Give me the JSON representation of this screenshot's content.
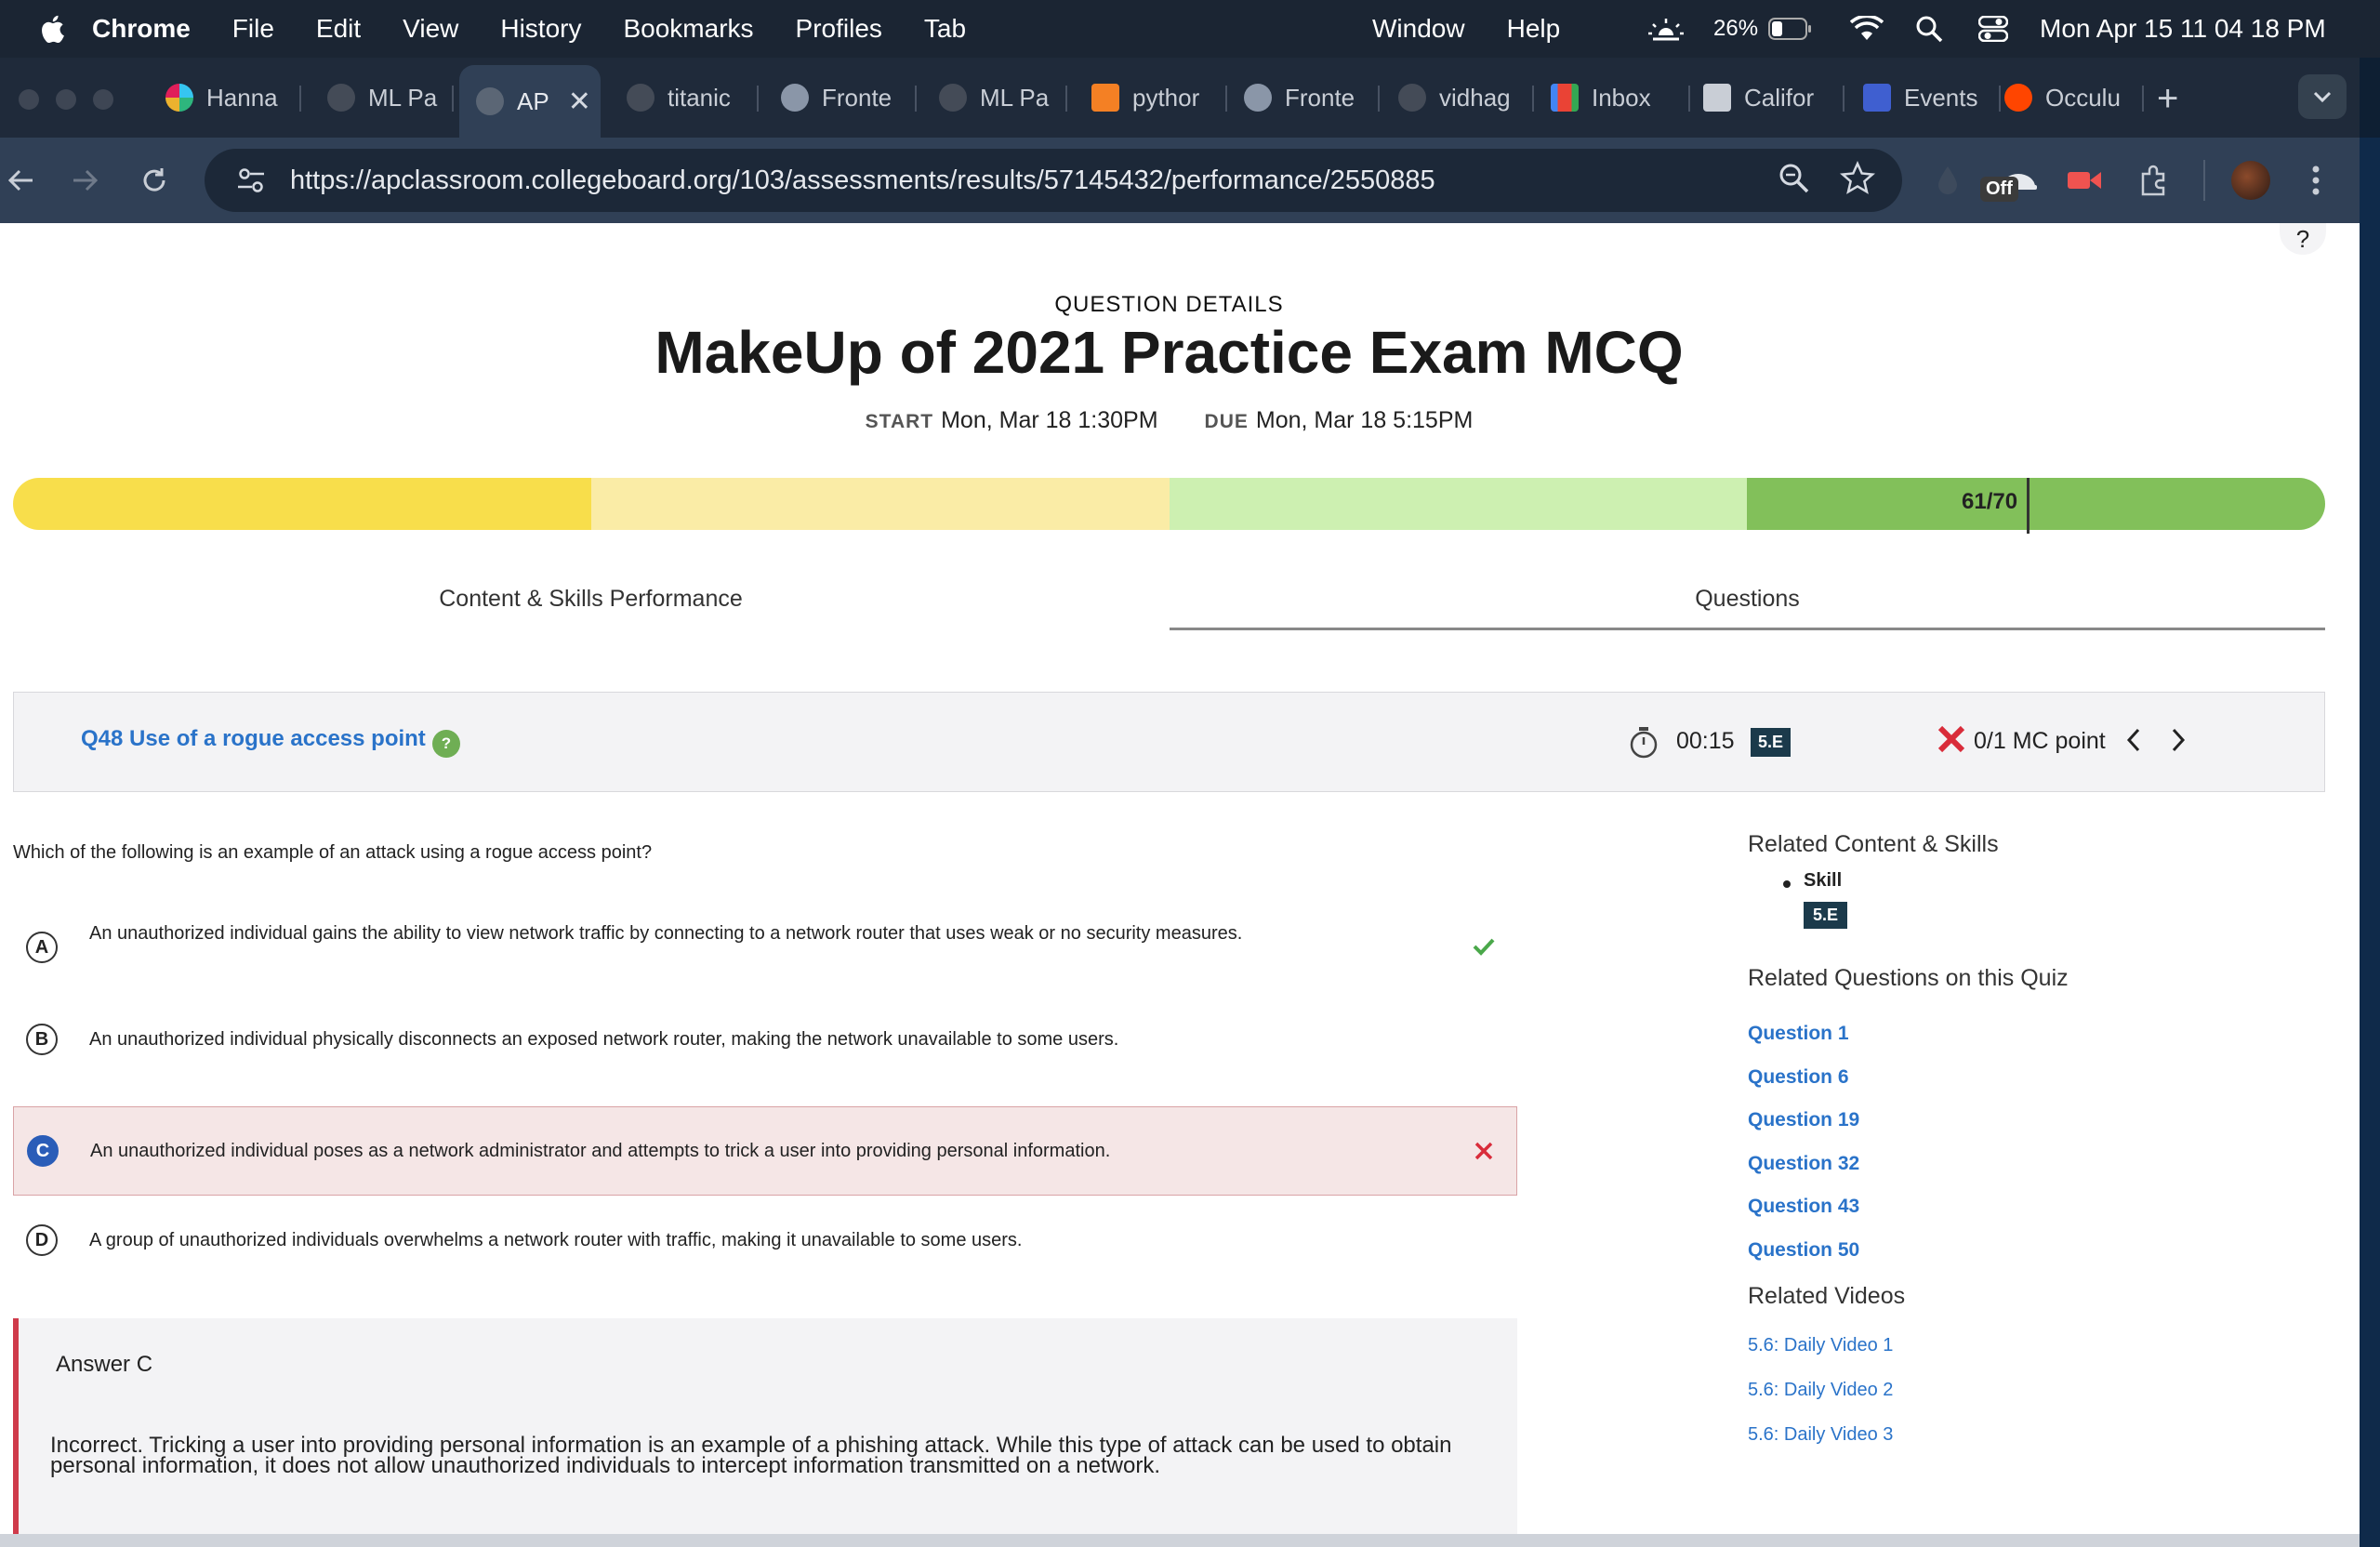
{
  "menubar": {
    "app": "Chrome",
    "items": [
      "File",
      "Edit",
      "View",
      "History",
      "Bookmarks",
      "Profiles",
      "Tab"
    ],
    "right_items": [
      "Window",
      "Help"
    ],
    "battery": "26%",
    "datetime": "Mon Apr 15  11 04 18 PM"
  },
  "tabs": [
    {
      "label": "Hanna",
      "icon": "slack-icon",
      "color": "#e01e5a"
    },
    {
      "label": "ML Pa",
      "icon": "github-icon",
      "color": "#444b57"
    },
    {
      "label": "AP",
      "icon": "globe-icon",
      "color": "#5b6675",
      "active": true
    },
    {
      "label": "titanic",
      "icon": "github-icon",
      "color": "#444b57"
    },
    {
      "label": "Fronte",
      "icon": "codeium-icon",
      "color": "#8a96a8"
    },
    {
      "label": "ML Pa",
      "icon": "github-icon",
      "color": "#444b57"
    },
    {
      "label": "pythor",
      "icon": "stackoverflow-icon",
      "color": "#f48024"
    },
    {
      "label": "Fronte",
      "icon": "codeium-icon",
      "color": "#8a96a8"
    },
    {
      "label": "vidhag",
      "icon": "github-icon",
      "color": "#444b57"
    },
    {
      "label": "Inbox",
      "icon": "gmail-icon",
      "color": "#ea4335"
    },
    {
      "label": "Califor",
      "icon": "graduation-cap-icon",
      "color": "#c9ced6"
    },
    {
      "label": "Events",
      "icon": "calendar-icon",
      "color": "#3f5fd0"
    },
    {
      "label": "Occulu",
      "icon": "reddit-icon",
      "color": "#ff4500"
    }
  ],
  "toolbar": {
    "url": "https://apclassroom.collegeboard.org/103/assessments/results/57145432/performance/2550885",
    "ext_badge": "Off"
  },
  "page": {
    "help": "?",
    "eyebrow": "QUESTION DETAILS",
    "title": "MakeUp of 2021 Practice Exam MCQ",
    "start_label": "START",
    "start_value": "Mon, Mar 18 1:30PM",
    "due_label": "DUE",
    "due_value": "Mon, Mar 18 5:15PM",
    "score": "61/70",
    "score_fraction": 0.871,
    "score_colors": [
      "#f8de4b",
      "#faeca6",
      "#cdf0b1",
      "#82c05a"
    ],
    "tabs": [
      "Content & Skills Performance",
      "Questions"
    ],
    "active_tab": "Questions",
    "question_header": {
      "title": "Q48 Use of a rogue access point",
      "timer": "00:15",
      "skill": "5.E",
      "points": "0/1 MC point"
    },
    "question": "Which of the following is an example of an attack using a rogue access point?",
    "choices": [
      {
        "letter": "A",
        "text": "An unauthorized individual gains the ability to view network traffic by connecting to a network router that uses weak or no security measures.",
        "status": "correct"
      },
      {
        "letter": "B",
        "text": "An unauthorized individual physically disconnects an exposed network router, making the network unavailable to some users.",
        "status": "none"
      },
      {
        "letter": "C",
        "text": "An unauthorized individual poses as a network administrator and attempts to trick a user into providing personal information.",
        "status": "selected-incorrect"
      },
      {
        "letter": "D",
        "text": "A group of unauthorized individuals overwhelms a network router with traffic, making it unavailable to some users.",
        "status": "none"
      }
    ],
    "answer_label": "Answer C",
    "explanation": "Incorrect. Tricking a user into providing personal information is an example of a phishing attack. While this type of attack can be used to obtain personal information, it does not allow unauthorized individuals to intercept information transmitted on a network."
  },
  "sidebar": {
    "related_content_heading": "Related Content & Skills",
    "skill_label": "Skill",
    "skill_tag": "5.E",
    "related_questions_heading": "Related Questions on this Quiz",
    "questions": [
      "Question 1",
      "Question 6",
      "Question 19",
      "Question 32",
      "Question 43",
      "Question 50"
    ],
    "related_videos_heading": "Related Videos",
    "videos": [
      "5.6: Daily Video 1",
      "5.6: Daily Video 2",
      "5.6: Daily Video 3"
    ]
  },
  "colors": {
    "link": "#2a73c9",
    "incorrect": "#d92c3a",
    "correct": "#4aa84a",
    "skill_tag": "#1b3a4b"
  }
}
